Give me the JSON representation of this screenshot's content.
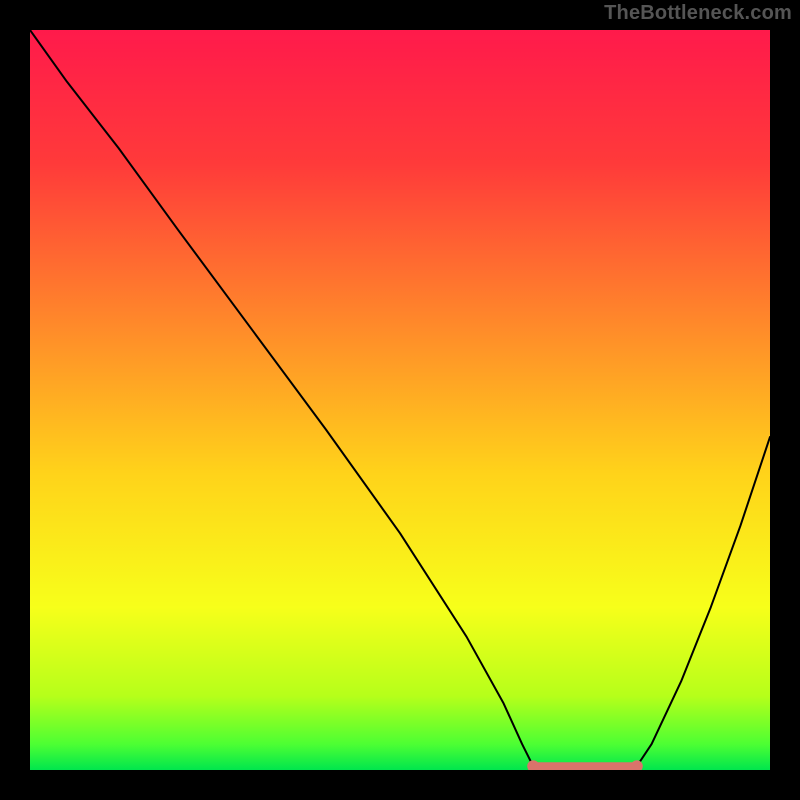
{
  "watermark": "TheBottleneck.com",
  "chart_data": {
    "type": "line",
    "title": "",
    "xlabel": "",
    "ylabel": "",
    "xlim": [
      0,
      100
    ],
    "ylim": [
      0,
      100
    ],
    "grid": false,
    "legend": false,
    "gradient_stops": [
      {
        "offset": 0.0,
        "color": "#ff1a4b"
      },
      {
        "offset": 0.18,
        "color": "#ff3a3a"
      },
      {
        "offset": 0.4,
        "color": "#ff8a2a"
      },
      {
        "offset": 0.6,
        "color": "#ffd31a"
      },
      {
        "offset": 0.78,
        "color": "#f7ff1a"
      },
      {
        "offset": 0.9,
        "color": "#b6ff1a"
      },
      {
        "offset": 0.965,
        "color": "#4dff33"
      },
      {
        "offset": 1.0,
        "color": "#00e64d"
      }
    ],
    "series": [
      {
        "name": "left-branch",
        "x": [
          0.0,
          5.0,
          12.0,
          20.0,
          30.0,
          40.0,
          50.0,
          59.0,
          64.0,
          66.5,
          68.0
        ],
        "y": [
          100.0,
          93.0,
          84.0,
          73.0,
          59.5,
          46.0,
          32.0,
          18.0,
          9.0,
          3.5,
          0.5
        ]
      },
      {
        "name": "right-branch",
        "x": [
          82.0,
          84.0,
          88.0,
          92.0,
          96.0,
          100.0
        ],
        "y": [
          0.5,
          3.5,
          12.0,
          22.0,
          33.0,
          45.0
        ]
      }
    ],
    "optimal_band": {
      "x_start": 68.0,
      "x_end": 82.0,
      "y": 0.5,
      "color": "#d9736b",
      "endpoint_dots": true
    }
  }
}
